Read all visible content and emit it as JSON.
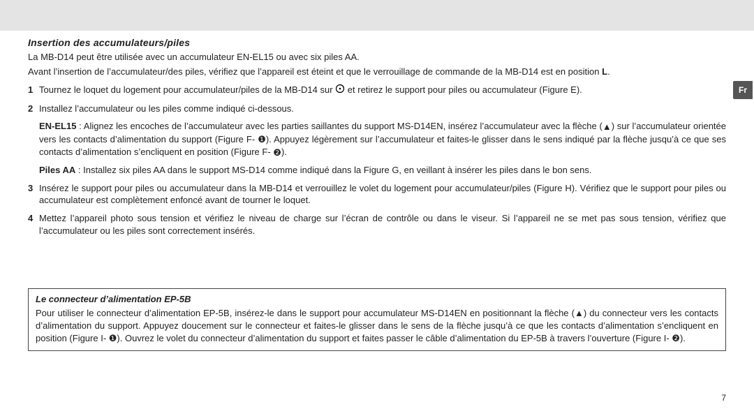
{
  "lang_tab": "Fr",
  "page_number": "7",
  "heading": "Insertion des accumulateurs/piles",
  "intro": "La MB-D14 peut être utilisée avec un accumulateur EN-EL15 ou avec six piles AA.",
  "preface_a": "Avant l’insertion de l’accumulateur/des piles, vérifiez que l’appareil est éteint et que le verrouillage de commande de la MB-D14 est en position ",
  "preface_L": "L",
  "preface_b": ".",
  "step1_a": "Tournez le loquet du logement pour accumulateur/piles de la MB-D14 sur ",
  "step1_b": " et retirez le support pour piles ou accumulateur (Figure E).",
  "step2": "Installez l’accumulateur ou les piles comme indiqué ci-dessous.",
  "enel15_label": "EN-EL15",
  "enel15_a": " : Alignez les encoches de l’accumulateur avec les parties saillantes du support MS-D14EN, insérez l’accumulateur avec la flèche (",
  "enel15_b": ") sur l’accumu­lateur orientée vers les contacts d’alimentation du support (Figure F- ",
  "enel15_c": "). Appuyez légèrement sur l’accumulateur et faites-le glisser dans le sens indiqué par la flèche jusqu’à ce que ses contacts d’alimentation s’encliquent en position (Figure F- ",
  "enel15_d": ").",
  "pilesaa_label": "Piles AA",
  "pilesaa_text": " : Installez six piles AA dans le support MS-D14 comme indiqué dans la Figure G, en veillant à insérer les piles dans le bon sens.",
  "step3": "Insérez le support pour piles ou accumulateur dans la MB-D14 et verrouillez le volet du logement pour accumulateur/piles (Figure H). Vérifiez que le support pour piles ou accumulateur est complètement enfoncé avant de tourner le loquet.",
  "step4": "Mettez l’appareil photo sous tension et vérifiez le niveau de charge sur l’écran de contrôle ou dans le viseur. Si l’appareil ne se met pas sous tension, vérifiez que l’accumulateur ou les piles sont correctement insérés.",
  "box_title": "Le connecteur d’alimentation EP-5B",
  "box_a": "Pour utiliser le connecteur d’alimentation EP-5B, insérez-le dans le support pour accumulateur MS-D14EN en positionnant la flèche (",
  "box_b": ") du connecteur vers les contacts d’alimentation du support. Appuyez doucement sur le connecteur et faites-le glisser dans le sens de la flèche jusqu’à ce que les contacts d’alimentation s’encliquent en position (Figure I- ",
  "box_c": "). Ouvrez le volet du connecteur d’alimentation du support et faites passer le câble d’alimentation du EP-5B à travers l’ouverture (Figure I- ",
  "box_d": ")."
}
